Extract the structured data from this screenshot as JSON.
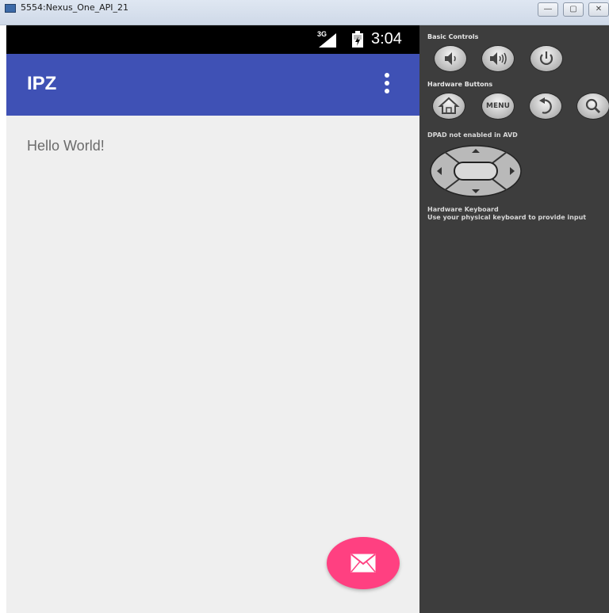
{
  "window": {
    "title": "5554:Nexus_One_API_21",
    "minimize_label": "—",
    "maximize_label": "▢",
    "close_label": "✕"
  },
  "status_bar": {
    "network": "3G",
    "time": "3:04"
  },
  "app": {
    "title": "IPZ",
    "content_text": "Hello World!"
  },
  "controls_panel": {
    "basic_controls_label": "Basic Controls",
    "hardware_buttons_label": "Hardware Buttons",
    "menu_button_label": "MENU",
    "dpad_label": "DPAD not enabled in AVD",
    "keyboard_label": "Hardware Keyboard",
    "keyboard_hint": "Use your physical keyboard to provide input"
  },
  "icons": {
    "basic_controls": [
      "volume-down-icon",
      "volume-up-icon",
      "power-icon"
    ],
    "hardware_buttons": [
      "home-icon",
      "menu-icon",
      "back-icon",
      "search-icon"
    ],
    "fab": "email-icon"
  },
  "colors": {
    "toolbar": "#3f51b5",
    "fab": "#ff4081",
    "panel": "#3d3d3d",
    "status_bar": "#000000"
  }
}
